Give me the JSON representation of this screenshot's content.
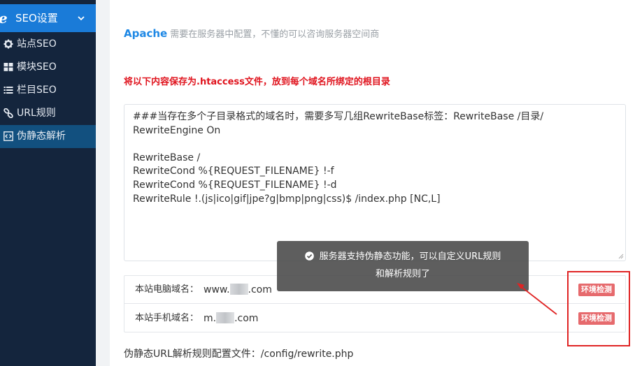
{
  "sidebar": {
    "header": {
      "label": "SEO设置",
      "logo_icon": "e-logo-icon",
      "chevron_icon": "chevron-down-icon"
    },
    "items": [
      {
        "label": "站点SEO",
        "icon": "gear-icon",
        "active": false
      },
      {
        "label": "模块SEO",
        "icon": "grid-icon",
        "active": false
      },
      {
        "label": "栏目SEO",
        "icon": "list-icon",
        "active": false
      },
      {
        "label": "URL规则",
        "icon": "link-icon",
        "active": false
      },
      {
        "label": "伪静态解析",
        "icon": "code-icon",
        "active": true
      }
    ]
  },
  "main": {
    "apache_title": "Apache",
    "apache_desc": "需要在服务器中配置，不懂的可以咨询服务器空间商",
    "warning": "将以下内容保存为.htaccess文件，放到每个域名所绑定的根目录",
    "code_lines": [
      "###当存在多个子目录格式的域名时，需要多写几组RewriteBase标签：RewriteBase /目录/",
      "RewriteEngine On",
      "",
      "RewriteBase /",
      "RewriteCond %{REQUEST_FILENAME} !-f",
      "RewriteCond %{REQUEST_FILENAME} !-d",
      "RewriteRule !.(js|ico|gif|jpe?g|bmp|png|css)$ /index.php [NC,L]"
    ],
    "domains": [
      {
        "label": "本站电脑域名：",
        "prefix": "www.",
        "suffix": ".com",
        "button": "环境检测"
      },
      {
        "label": "本站手机域名：",
        "prefix": "m.",
        "suffix": ".com",
        "button": "环境检测"
      }
    ],
    "config_file": "伪静态URL解析规则配置文件：/config/rewrite.php"
  },
  "toast": {
    "line1": "服务器支持伪静态功能，可以自定义URL规则",
    "line2": "和解析规则了",
    "icon": "check-circle-icon"
  },
  "colors": {
    "sidebar_bg": "#14253d",
    "accent": "#1a7bd8",
    "active_bg": "#12507f",
    "warning": "#e0141e",
    "badge": "#e66a6d",
    "annotation": "#e02424"
  }
}
